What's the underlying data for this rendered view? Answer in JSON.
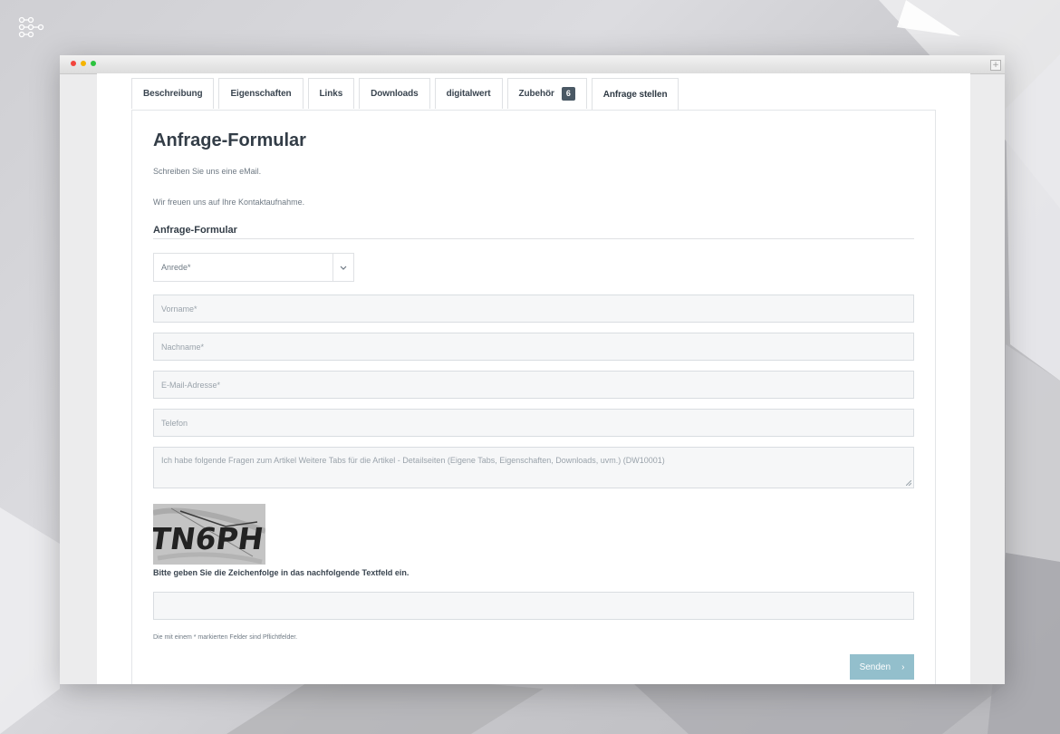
{
  "brand": {
    "logo_icon": "network-nodes-icon"
  },
  "window": {
    "controls": [
      "close",
      "minimize",
      "zoom"
    ],
    "expand_icon": "+"
  },
  "tabs": [
    {
      "label": "Beschreibung"
    },
    {
      "label": "Eigenschaften"
    },
    {
      "label": "Links"
    },
    {
      "label": "Downloads"
    },
    {
      "label": "digitalwert"
    },
    {
      "label": "Zubehör",
      "badge": "6"
    },
    {
      "label": "Anfrage stellen",
      "active": true
    }
  ],
  "form": {
    "title": "Anfrage-Formular",
    "intro_line1": "Schreiben Sie uns eine eMail.",
    "intro_line2": "Wir freuen uns auf Ihre Kontaktaufnahme.",
    "section_title": "Anfrage-Formular",
    "salutation": {
      "value": "Anrede*",
      "icon": "chevron-down-icon"
    },
    "first_name_placeholder": "Vorname*",
    "last_name_placeholder": "Nachname*",
    "email_placeholder": "E-Mail-Adresse*",
    "phone_placeholder": "Telefon",
    "message_placeholder": "Ich habe folgende Fragen zum Artikel Weitere Tabs für die Artikel - Detailseiten (Eigene Tabs, Eigenschaften, Downloads, uvm.) (DW10001)",
    "captcha_text": "TN6PH",
    "captcha_label": "Bitte geben Sie die Zeichenfolge in das nachfolgende Textfeld ein.",
    "required_note": "Die mit einem * markierten Felder sind Pflichtfelder.",
    "submit_label": "Senden",
    "submit_icon": "chevron-right-icon"
  },
  "colors": {
    "accent_button": "#93bfcc",
    "badge": "#4a5864",
    "text": "#333d47"
  }
}
